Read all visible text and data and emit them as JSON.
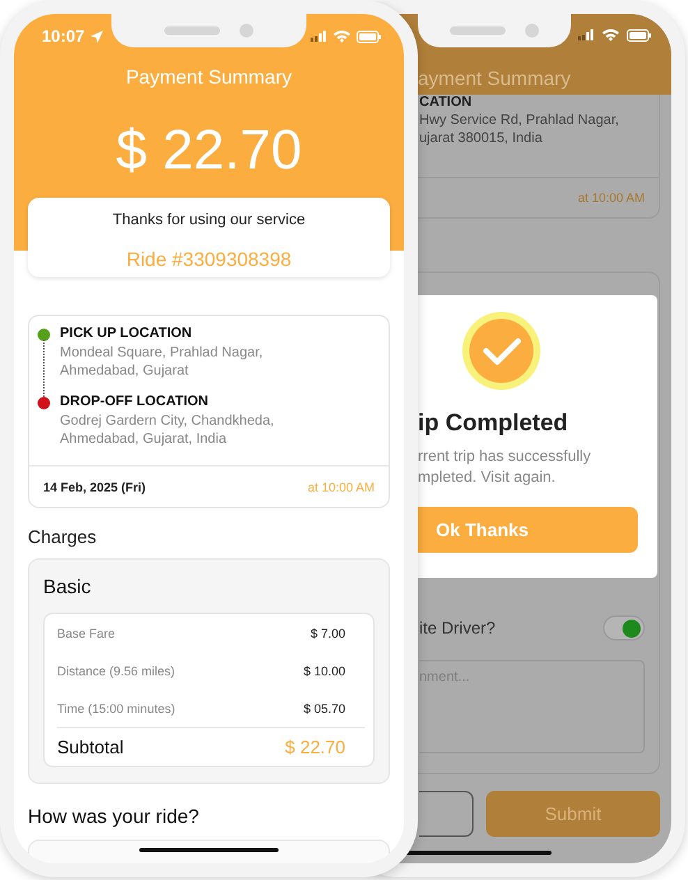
{
  "front_phone": {
    "status_bar": {
      "time": "10:07"
    },
    "title": "Payment Summary",
    "amount": "$ 22.70",
    "thanks": "Thanks for using our service",
    "ride_id": "Ride #3309308398",
    "trip": {
      "stops": [
        {
          "kind": "pickup",
          "label": "PICK UP LOCATION",
          "address": "Mondeal Square, Prahlad Nagar, Ahmedabad, Gujarat",
          "color": "#55a01a"
        },
        {
          "kind": "dropoff",
          "label": "DROP-OFF LOCATION",
          "address": "Godrej Gardern City, Chandkheda, Ahmedabad, Gujarat, India",
          "color": "#d0101a"
        }
      ],
      "date": "14 Feb, 2025 (Fri)",
      "time": "at 10:00 AM"
    },
    "charges": {
      "heading": "Charges",
      "plan": "Basic",
      "items": [
        {
          "label": "Base Fare",
          "amount": "$ 7.00"
        },
        {
          "label": "Distance (9.56 miles)",
          "amount": "$ 10.00"
        },
        {
          "label": "Time (15:00 minutes)",
          "amount": "$ 05.70"
        }
      ],
      "subtotal": {
        "label": "Subtotal",
        "amount": "$ 22.70"
      }
    },
    "rating_heading": "How was your ride?"
  },
  "back_phone": {
    "title": "ayment Summary",
    "location_label": "CATION",
    "address_lines": [
      "Hwy Service Rd, Prahlad Nagar,",
      "ujarat 380015, India"
    ],
    "time": "at 10:00 AM",
    "favorite": {
      "label": "ite Driver?",
      "on": true
    },
    "comment": {
      "placeholder": "nment..."
    },
    "submit": "Submit",
    "dialog": {
      "title": "ip Completed",
      "message_lines": [
        "rrent trip has successfully",
        "mpleted. Visit again."
      ],
      "button": "Ok Thanks"
    }
  }
}
